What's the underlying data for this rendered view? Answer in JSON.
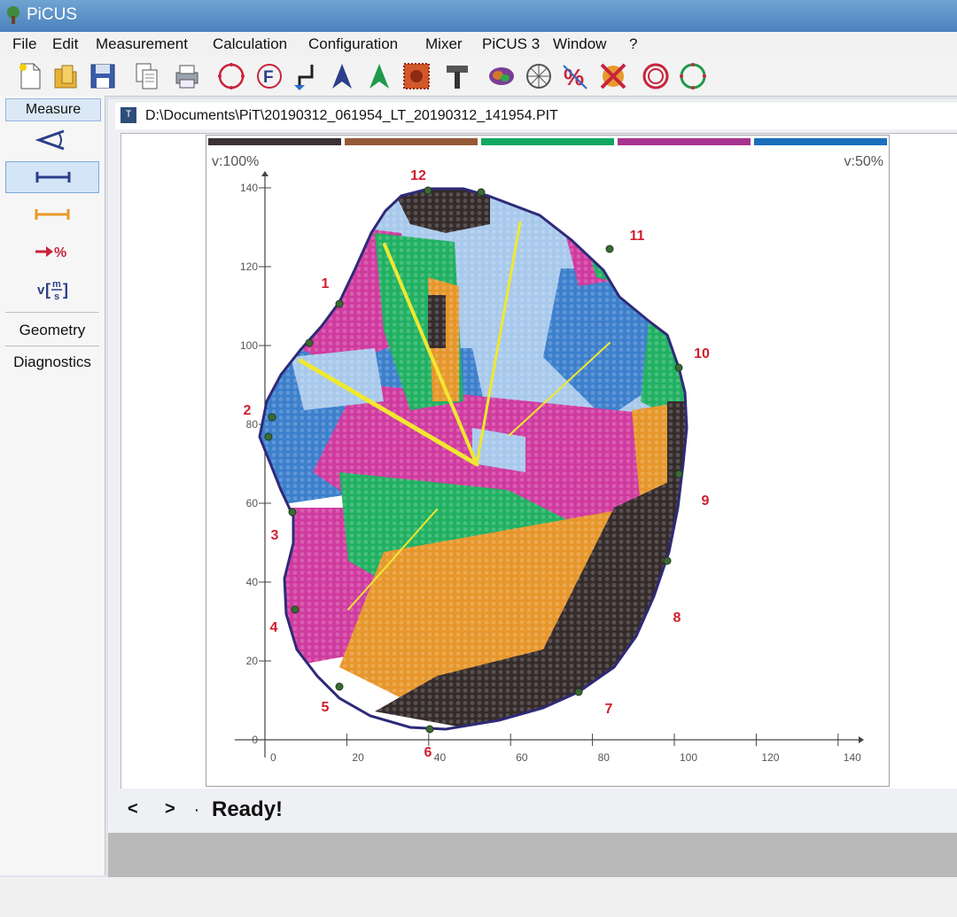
{
  "window": {
    "title": "PiCUS"
  },
  "menu": [
    "File",
    "Edit",
    "Measurement",
    "Calculation",
    "Configuration",
    "Mixer",
    "PiCUS 3",
    "Window",
    "?"
  ],
  "toolbar": {
    "icons": [
      "new-file-icon",
      "open-folder-icon",
      "save-disk-icon",
      "copy-icon",
      "print-icon",
      "circle-outline-icon",
      "f-circle-icon",
      "geometry-path-icon",
      "arrow-a-blue-icon",
      "arrow-a-green-icon",
      "red-dotted-frame-icon",
      "hammer-icon",
      "tomogram-icon",
      "web-circle-icon",
      "percent-icon",
      "cross-icon",
      "ring-red-icon",
      "ring-green-icon"
    ]
  },
  "left_panel": {
    "header": "Measure",
    "tools": [
      "angle-icon",
      "distance-blue-icon",
      "distance-orange-icon",
      "arrow-percent-icon",
      "velocity-icon"
    ],
    "arrow_percent_label": "%",
    "velocity_label": "v",
    "velocity_unit_num": "m",
    "velocity_unit_den": "s",
    "sections": [
      "Geometry",
      "Diagnostics"
    ]
  },
  "document": {
    "path": "D:\\Documents\\PiT\\20190312_061954_LT_20190312_141954.PIT",
    "icon_text": "T"
  },
  "plot": {
    "v_left": "v:100%",
    "v_right": "v:50%",
    "legend_colors": [
      "#3b3233",
      "#955a37",
      "#10a860",
      "#a8338e",
      "#1b6fbd"
    ],
    "x_ticks": [
      0,
      20,
      40,
      60,
      80,
      100,
      120,
      140
    ],
    "y_ticks": [
      0,
      20,
      40,
      60,
      80,
      100,
      120,
      140
    ],
    "sensors": [
      {
        "label": "1"
      },
      {
        "label": "2"
      },
      {
        "label": "3"
      },
      {
        "label": "4"
      },
      {
        "label": "5"
      },
      {
        "label": "6"
      },
      {
        "label": "7"
      },
      {
        "label": "8"
      },
      {
        "label": "9"
      },
      {
        "label": "10"
      },
      {
        "label": "11"
      },
      {
        "label": "12"
      }
    ],
    "colors": {
      "outline": "#2e2a78",
      "sensor_label": "#d01f2e",
      "ray": "#f0e830"
    }
  },
  "status": {
    "prev": "<",
    "next": ">",
    "dot": "·",
    "text": "Ready!"
  }
}
